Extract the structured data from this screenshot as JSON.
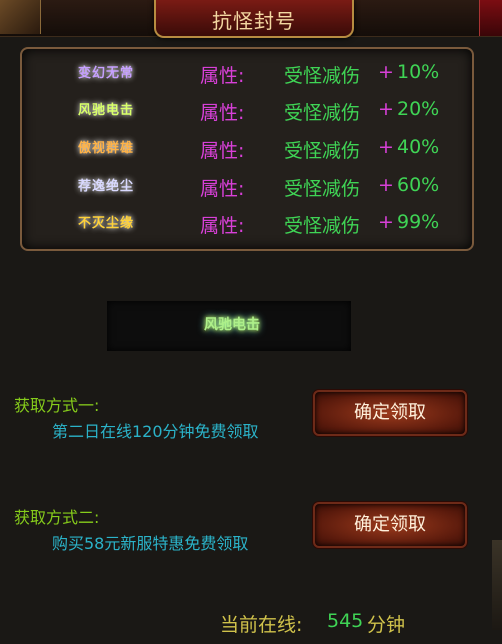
{
  "header": {
    "title": "抗怪封号"
  },
  "titles": [
    {
      "name": "变幻无常",
      "attribute_label": "属性:",
      "attribute_name": "受怪减伤",
      "plus": "+",
      "percent": "10%",
      "color": "#c6a0ff"
    },
    {
      "name": "风驰电击",
      "attribute_label": "属性:",
      "attribute_name": "受怪减伤",
      "plus": "+",
      "percent": "20%",
      "color": "#d8ff6a"
    },
    {
      "name": "傲视群雄",
      "attribute_label": "属性:",
      "attribute_name": "受怪减伤",
      "plus": "+",
      "percent": "40%",
      "color": "#ffb347"
    },
    {
      "name": "荐逸绝尘",
      "attribute_label": "属性:",
      "attribute_name": "受怪减伤",
      "plus": "+",
      "percent": "60%",
      "color": "#d9d9ff"
    },
    {
      "name": "不灭尘缘",
      "attribute_label": "属性:",
      "attribute_name": "受怪减伤",
      "plus": "+",
      "percent": "99%",
      "color": "#ffd23a"
    }
  ],
  "preview": {
    "name": "风驰电击"
  },
  "methods": [
    {
      "label": "获取方式一:",
      "desc": "第二日在线120分钟免费领取",
      "button": "确定领取"
    },
    {
      "label": "获取方式二:",
      "desc": "购买58元新服特惠免费领取",
      "button": "确定领取"
    }
  ],
  "online": {
    "label": "当前在线:",
    "value": "545",
    "unit": "分钟"
  },
  "colors": {
    "attribute": "#d840d8",
    "value": "#3fd455",
    "method_label": "#86cc1b",
    "method_desc": "#2bb3c9",
    "button_bg": "#7a2a14"
  }
}
